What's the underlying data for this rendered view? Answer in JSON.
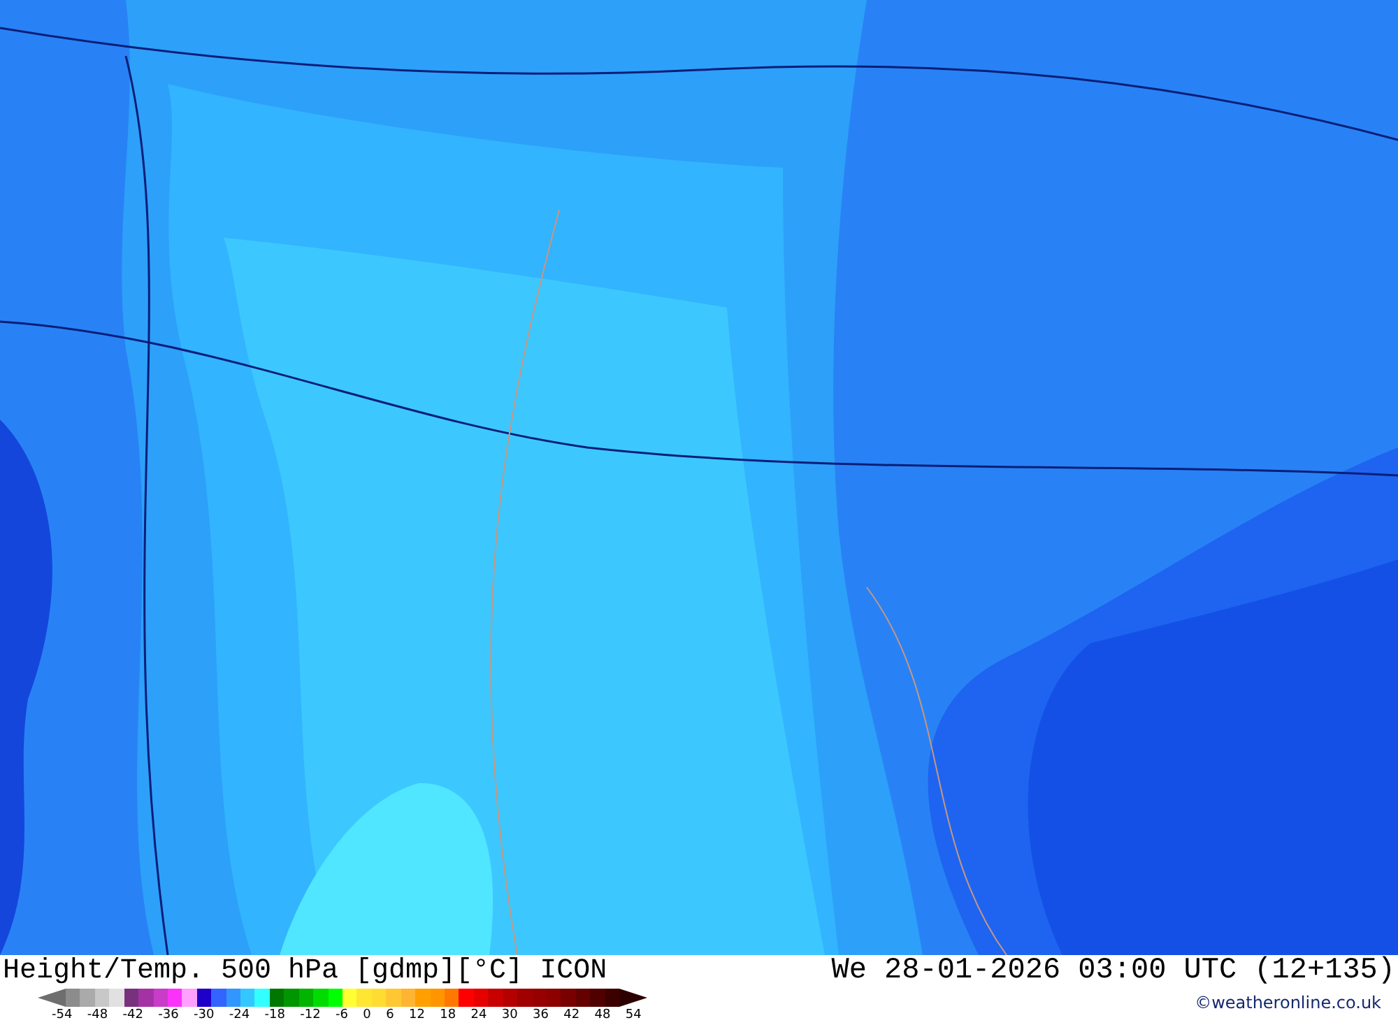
{
  "title": "Height/Temp. 500 hPa [gdmp][°C] ICON",
  "valid_time": "We 28-01-2026 03:00 UTC (12+135)",
  "credit": "©weatheronline.co.uk",
  "legend": {
    "swatches": [
      {
        "kind": "arrow-left",
        "color": "#6e6e6e"
      },
      {
        "color": "#8c8c8c"
      },
      {
        "color": "#aaaaaa"
      },
      {
        "color": "#c8c8c8"
      },
      {
        "color": "#e1e1e1"
      },
      {
        "color": "#78327d"
      },
      {
        "color": "#a532a5"
      },
      {
        "color": "#c83cc8"
      },
      {
        "color": "#fa32fa"
      },
      {
        "color": "#ffa0ff"
      },
      {
        "color": "#1e00c8"
      },
      {
        "color": "#3264ff"
      },
      {
        "color": "#3296ff"
      },
      {
        "color": "#32c8ff"
      },
      {
        "color": "#32ffff"
      },
      {
        "color": "#007800"
      },
      {
        "color": "#009600"
      },
      {
        "color": "#00b400"
      },
      {
        "color": "#00dc00"
      },
      {
        "color": "#00ff00"
      },
      {
        "color": "#ffff32"
      },
      {
        "color": "#ffe632"
      },
      {
        "color": "#ffdc32"
      },
      {
        "color": "#ffc832"
      },
      {
        "color": "#ffb432"
      },
      {
        "color": "#ffa000"
      },
      {
        "color": "#ff9600"
      },
      {
        "color": "#ff7800"
      },
      {
        "color": "#ff0000"
      },
      {
        "color": "#e60000"
      },
      {
        "color": "#c80000"
      },
      {
        "color": "#b40000"
      },
      {
        "color": "#a00000"
      },
      {
        "color": "#960000"
      },
      {
        "color": "#8c0000"
      },
      {
        "color": "#780000"
      },
      {
        "color": "#640000"
      },
      {
        "color": "#500000"
      },
      {
        "color": "#3c0000"
      },
      {
        "kind": "arrow-right",
        "color": "#2d0000"
      }
    ],
    "labels": [
      "-54",
      "-48",
      "-42",
      "-36",
      "-30",
      "-24",
      "-18",
      "-12",
      "-6",
      "0",
      "6",
      "12",
      "18",
      "24",
      "30",
      "36",
      "42",
      "48",
      "54"
    ]
  }
}
